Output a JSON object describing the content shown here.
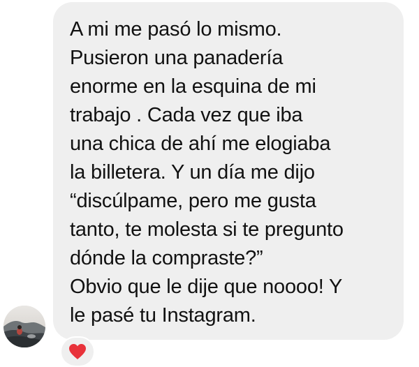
{
  "message": {
    "lines": [
      "A mi me pasó lo mismo.",
      "Pusieron una panadería",
      "enorme en la esquina de mi",
      "trabajo . Cada vez que iba",
      "una chica de ahí me elogiaba",
      "la billetera. Y un día me dijo",
      "“discúlpame, pero me gusta",
      "tanto, te molesta si te pregunto",
      "dónde la compraste?”",
      "Obvio que le dije que noooo! Y",
      "le pasé tu Instagram."
    ]
  },
  "reaction": {
    "icon": "heart-icon",
    "color": "#e8323a"
  },
  "sender": {
    "avatar_icon": "profile-photo"
  },
  "colors": {
    "bubble": "#efefef",
    "text": "#111111"
  }
}
